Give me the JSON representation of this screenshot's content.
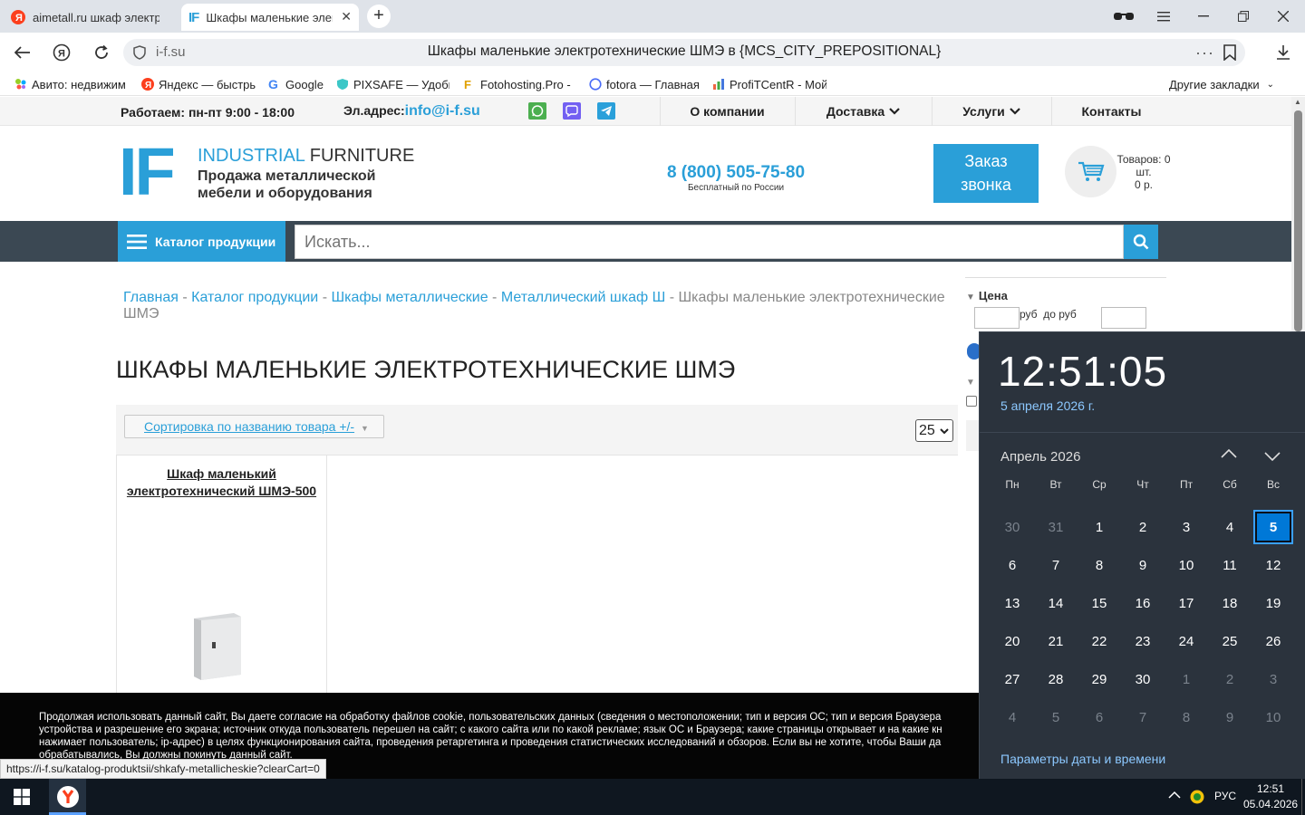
{
  "browser": {
    "tabs": [
      {
        "title": "aimetall.ru шкаф электрот",
        "active": false
      },
      {
        "title": "Шкафы маленькие элек",
        "active": true
      }
    ],
    "new_tab": "+",
    "address": {
      "domain": "i-f.su",
      "page_title": "Шкафы маленькие электротехнические ШМЭ в {MCS_CITY_PREPOSITIONAL}"
    },
    "bookmarks": [
      {
        "label": "Авито: недвижим",
        "icon": "avito-icon"
      },
      {
        "label": "Яндекс — быстры",
        "icon": "yandex-icon"
      },
      {
        "label": "Google",
        "icon": "google-icon"
      },
      {
        "label": "PIXSAFE — Удобн",
        "icon": "pixsafe-icon"
      },
      {
        "label": "Fotohosting.Pro -",
        "icon": "fotohosting-icon"
      },
      {
        "label": "fotora — Главная",
        "icon": "fotora-icon"
      },
      {
        "label": "ProfiTCentR - Мой",
        "icon": "chart-icon"
      }
    ],
    "other_bookmarks": "Другие закладки",
    "status_url": "https://i-f.su/katalog-produktsii/shkafy-metallicheskie?clearCart=0"
  },
  "site": {
    "work_hours": "Работаем: пн-пт 9:00 - 18:00",
    "email_label": "Эл.адрес:",
    "email": "info@i-f.su",
    "menu": [
      "О компании",
      "Доставка",
      "Услуги",
      "Контакты"
    ],
    "logo": {
      "mark": "IF",
      "brand_blue": "INDUSTRIAL",
      "brand_dark": "FURNITURE",
      "tagline1": "Продажа металлической",
      "tagline2": "мебели и оборудования"
    },
    "phone": "8 (800) 505-75-80",
    "phone_note": "Бесплатный по России",
    "callback": {
      "line1": "Заказ",
      "line2": "звонка"
    },
    "cart": {
      "items": "Товаров: 0",
      "unit": "шт.",
      "sum": "0 р."
    },
    "catalog_button": "Каталог продукции",
    "search_placeholder": "Искать...",
    "breadcrumbs": [
      "Главная",
      "Каталог продукции",
      "Шкафы металлические",
      "Металлический шкаф Ш"
    ],
    "breadcrumb_sep": "-",
    "breadcrumb_current": "Шкафы маленькие электротехнические ШМЭ",
    "page_title": "ШКАФЫ МАЛЕНЬКИЕ ЭЛЕКТРОТЕХНИЧЕСКИЕ ШМЭ",
    "sort_label": "Сортировка по названию товара +/-",
    "per_page": "25",
    "product": {
      "name_line1": "Шкаф маленький",
      "name_line2": "электротехнический ШМЭ-500"
    },
    "filter": {
      "title": "Цена",
      "from_unit": "руб",
      "to_label": "до",
      "to_unit": "руб"
    },
    "cookie_lines": [
      "Продолжая использовать данный сайт, Вы даете согласие на обработку файлов cookie, пользовательских данных (сведения о местоположении; тип и версия ОС; тип и версия Браузера",
      "устройства и разрешение его экрана; источник откуда пользователь перешел на сайт; с какого сайта или по какой рекламе; язык ОС и Браузера; какие страницы открывает и на какие кн",
      "нажимает пользователь; ip-адрес) в целях функционирования сайта, проведения ретаргетинга и проведения статистических исследований и обзоров. Если вы не хотите, чтобы Ваши да",
      "обрабатывались, Вы должны покинуть данный сайт."
    ]
  },
  "calendar": {
    "time": "12:51:05",
    "date": "5 апреля 2026 г.",
    "month": "Апрель 2026",
    "weekdays": [
      "Пн",
      "Вт",
      "Ср",
      "Чт",
      "Пт",
      "Сб",
      "Вс"
    ],
    "weeks": [
      [
        "30",
        "31",
        "1",
        "2",
        "3",
        "4",
        "5"
      ],
      [
        "6",
        "7",
        "8",
        "9",
        "10",
        "11",
        "12"
      ],
      [
        "13",
        "14",
        "15",
        "16",
        "17",
        "18",
        "19"
      ],
      [
        "20",
        "21",
        "22",
        "23",
        "24",
        "25",
        "26"
      ],
      [
        "27",
        "28",
        "29",
        "30",
        "1",
        "2",
        "3"
      ],
      [
        "4",
        "5",
        "6",
        "7",
        "8",
        "9",
        "10"
      ]
    ],
    "selected": "5",
    "settings_link": "Параметры даты и времени"
  },
  "taskbar": {
    "lang": "РУС",
    "time": "12:51",
    "date": "05.04.2026"
  },
  "colors": {
    "accent": "#2a9fd8",
    "dark_bar": "#3b4853",
    "calendar_bg": "#2b333d",
    "calendar_link": "#8cc8ff",
    "selected": "#0078d7"
  }
}
